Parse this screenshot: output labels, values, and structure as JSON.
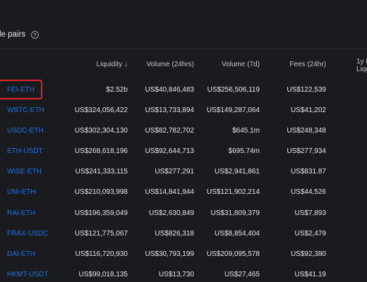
{
  "section": {
    "title": "le pairs",
    "help_icon": "question-circle-icon"
  },
  "table": {
    "headers": {
      "liquidity": "Liquidity ↓",
      "volume_24h": "Volume (24hrs)",
      "volume_7d": "Volume (7d)",
      "fees_24h": "Fees (24hr)",
      "fees_yield_line1": "1y F",
      "fees_yield_line2": "Liqu"
    },
    "rows": [
      {
        "pair": "FEI-ETH",
        "liquidity": "$2.52b",
        "volume_24h": "US$40,846,483",
        "volume_7d": "US$256,506,119",
        "fees_24h": "US$122,539"
      },
      {
        "pair": "WBTC-ETH",
        "liquidity": "US$324,056,422",
        "volume_24h": "US$13,733,894",
        "volume_7d": "US$149,287,064",
        "fees_24h": "US$41,202"
      },
      {
        "pair": "USDC-ETH",
        "liquidity": "US$302,304,130",
        "volume_24h": "US$82,782,702",
        "volume_7d": "$645.1m",
        "fees_24h": "US$248,348"
      },
      {
        "pair": "ETH-USDT",
        "liquidity": "US$268,618,196",
        "volume_24h": "US$92,644,713",
        "volume_7d": "$695.74m",
        "fees_24h": "US$277,934"
      },
      {
        "pair": "WISE-ETH",
        "liquidity": "US$241,333,115",
        "volume_24h": "US$277,291",
        "volume_7d": "US$2,941,861",
        "fees_24h": "US$831.87"
      },
      {
        "pair": "UNI-ETH",
        "liquidity": "US$210,093,998",
        "volume_24h": "US$14,841,944",
        "volume_7d": "US$121,902,214",
        "fees_24h": "US$44,526"
      },
      {
        "pair": "RAI-ETH",
        "liquidity": "US$196,359,049",
        "volume_24h": "US$2,630,849",
        "volume_7d": "US$31,809,379",
        "fees_24h": "US$7,893"
      },
      {
        "pair": "FRAX-USDC",
        "liquidity": "US$121,775,067",
        "volume_24h": "US$826,318",
        "volume_7d": "US$8,854,404",
        "fees_24h": "US$2,479"
      },
      {
        "pair": "DAI-ETH",
        "liquidity": "US$116,720,930",
        "volume_24h": "US$30,793,199",
        "volume_7d": "US$209,095,578",
        "fees_24h": "US$92,380"
      },
      {
        "pair": "HKMT-USDT",
        "liquidity": "US$99,018,135",
        "volume_24h": "US$13,730",
        "volume_7d": "US$27,465",
        "fees_24h": "US$41.19"
      }
    ]
  },
  "colors": {
    "background": "#191b1f",
    "link": "#2172e5",
    "highlight": "#e0242a"
  }
}
